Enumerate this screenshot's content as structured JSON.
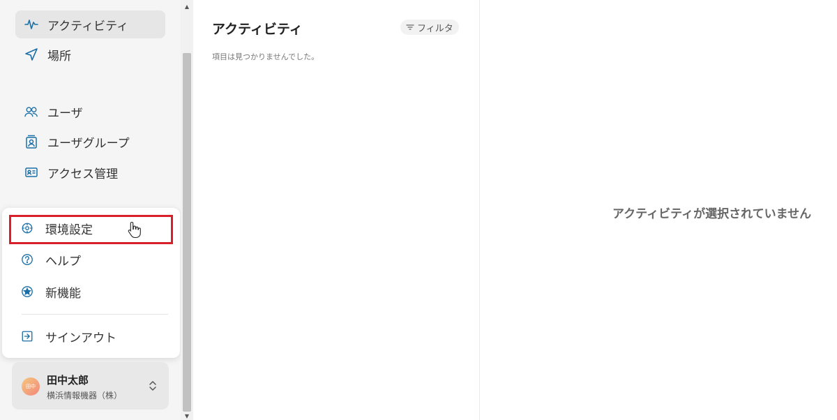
{
  "sidebar": {
    "items": [
      {
        "label": "アクティビティ",
        "icon": "activity-icon"
      },
      {
        "label": "場所",
        "icon": "location-arrow-icon"
      },
      {
        "label": "ユーザ",
        "icon": "users-icon"
      },
      {
        "label": "ユーザグループ",
        "icon": "user-group-icon"
      },
      {
        "label": "アクセス管理",
        "icon": "id-card-icon"
      }
    ]
  },
  "popup": {
    "items": [
      {
        "label": "環境設定",
        "icon": "settings-icon"
      },
      {
        "label": "ヘルプ",
        "icon": "help-icon"
      },
      {
        "label": "新機能",
        "icon": "star-icon"
      },
      {
        "label": "サインアウト",
        "icon": "sign-out-icon"
      }
    ]
  },
  "user": {
    "avatar_text": "田中",
    "name": "田中太郎",
    "org": "横浜情報機器（株）"
  },
  "activity": {
    "title": "アクティビティ",
    "filter_label": "フィルタ",
    "empty_message": "項目は見つかりませんでした。"
  },
  "detail": {
    "empty_message": "アクティビティが選択されていません"
  },
  "colors": {
    "accent": "#1b6fa8",
    "highlight": "#d9202a"
  }
}
